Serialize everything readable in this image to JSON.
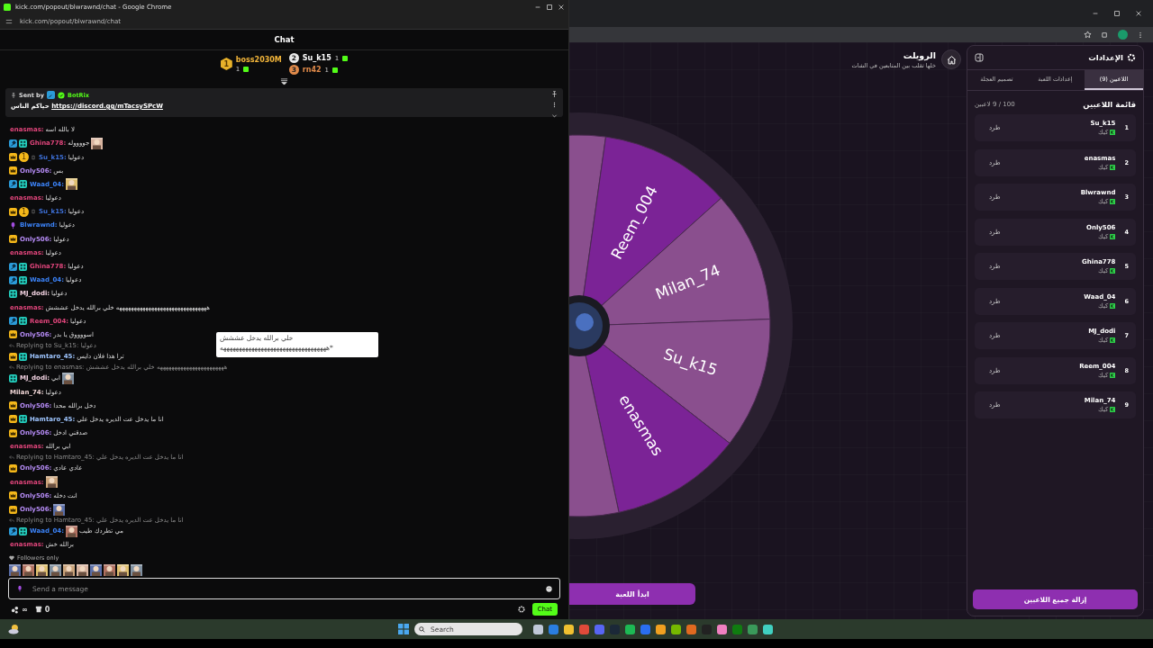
{
  "chat_window": {
    "title": "kick.com/popout/blwrawnd/chat - Google Chrome",
    "url": "kick.com/popout/blwrawnd/chat",
    "heading": "Chat",
    "top_gifter": {
      "rank": "1",
      "name": "boss2030M",
      "count": "1"
    },
    "runners_up": [
      {
        "rank": "2",
        "name": "Su_k15",
        "count": "1"
      },
      {
        "rank": "3",
        "name": "rn42",
        "count": "1"
      }
    ],
    "pinned": {
      "label": "Sent by",
      "sender": "BotRix",
      "text": "حياكم الناس",
      "link": "https://discord.gg/mTacsySPcW"
    },
    "messages": [
      {
        "user": "enasmas:",
        "color": "#e0457b",
        "text": "لا بالله اسه"
      },
      {
        "user": "Ghina778:",
        "color": "#e0457b",
        "badges": [
          {
            "kind": "hammer"
          },
          {
            "kind": "og"
          }
        ],
        "text": "جووووله",
        "emote_after": {
          "kind": "picture"
        }
      },
      {
        "user": "Su_k15:",
        "color": "#3d6fd6",
        "badges": [
          {
            "kind": "crown"
          },
          {
            "kind": "coin",
            "label": "1"
          },
          {
            "kind": "emblem"
          }
        ],
        "text": "دعوليا"
      },
      {
        "user": "Only506:",
        "color": "#b58bf5",
        "badges": [
          {
            "kind": "crown"
          }
        ],
        "text": "بس"
      },
      {
        "user": "Waad_04:",
        "color": "#3b82f6",
        "badges": [
          {
            "kind": "hammer"
          },
          {
            "kind": "og"
          }
        ],
        "emote_after": {
          "kind": "picture"
        }
      },
      {
        "user": "enasmas:",
        "color": "#e0457b",
        "text": "دعوليا"
      },
      {
        "user": "Su_k15:",
        "color": "#3d6fd6",
        "badges": [
          {
            "kind": "crown"
          },
          {
            "kind": "coin",
            "label": "1"
          },
          {
            "kind": "emblem"
          }
        ],
        "text": "دعوليا"
      },
      {
        "user": "Blwrawnd:",
        "color": "#3b82f6",
        "badges": [
          {
            "kind": "mic"
          }
        ],
        "text": "دعوليا"
      },
      {
        "user": "Only506:",
        "color": "#b58bf5",
        "badges": [
          {
            "kind": "crown"
          }
        ],
        "text": "دعوليا"
      },
      {
        "user": "enasmas:",
        "color": "#e0457b",
        "text": "دعوليا"
      },
      {
        "user": "Ghina778:",
        "color": "#e0457b",
        "badges": [
          {
            "kind": "hammer"
          },
          {
            "kind": "og"
          }
        ],
        "text": "دعوليا"
      },
      {
        "user": "Waad_04:",
        "color": "#3b82f6",
        "badges": [
          {
            "kind": "hammer"
          },
          {
            "kind": "og"
          }
        ],
        "text": "دعوليا"
      },
      {
        "user": "MJ_dodi:",
        "color": "#f3d3e2",
        "badges": [
          {
            "kind": "og"
          }
        ],
        "text": "دعوليا"
      },
      {
        "user": "enasmas:",
        "color": "#e0457b",
        "text": "هههههههههههههههههههههههههههههههه خلي برالله يدخل عششش"
      },
      {
        "user": "Reem_004:",
        "color": "#e0457b",
        "badges": [
          {
            "kind": "hammer"
          },
          {
            "kind": "og"
          }
        ],
        "text": "دعوليا"
      },
      {
        "user": "Only506:",
        "color": "#b58bf5",
        "badges": [
          {
            "kind": "crown"
          }
        ],
        "text": "اسووووق يا بدر"
      },
      {
        "reply": "Replying to Su_k15: دعوليا",
        "user": "Hamtaro_45:",
        "color": "#9ec5ff",
        "badges": [
          {
            "kind": "crown"
          },
          {
            "kind": "og"
          }
        ],
        "text": "ترا هذا فلان دايس"
      },
      {
        "reply": "Replying to enasmas: هههههههههههههههههههههههه خلي برالله يدخل عششش",
        "user": "MJ_dodi:",
        "color": "#f3d3e2",
        "badges": [
          {
            "kind": "og"
          }
        ],
        "text": "ابي",
        "emote_after": {
          "kind": "picture"
        }
      },
      {
        "user": "Milan_74:",
        "color": "#f0d6d6",
        "text": "دعوليا"
      },
      {
        "user": "Only506:",
        "color": "#b58bf5",
        "badges": [
          {
            "kind": "crown"
          }
        ],
        "text": "دخل برالله محدا"
      },
      {
        "user": "Hamtaro_45:",
        "color": "#9ec5ff",
        "badges": [
          {
            "kind": "crown"
          },
          {
            "kind": "og"
          }
        ],
        "text": "انا ما يدخل عت الديره يدخل علي"
      },
      {
        "user": "Only506:",
        "color": "#b58bf5",
        "badges": [
          {
            "kind": "crown"
          }
        ],
        "text": "صدقني ادخل"
      },
      {
        "user": "enasmas:",
        "color": "#e0457b",
        "text": "ابي برالله"
      },
      {
        "reply": "Replying to Hamtaro_45: انا ما يدخل عت الديره يدخل علي",
        "user": "Only506:",
        "color": "#b58bf5",
        "badges": [
          {
            "kind": "crown"
          }
        ],
        "text": "عادي عادي"
      },
      {
        "user": "enasmas:",
        "color": "#e0457b",
        "emote_after": {
          "kind": "picture"
        }
      },
      {
        "user": "Only506:",
        "color": "#b58bf5",
        "badges": [
          {
            "kind": "crown"
          }
        ],
        "text": "انت دخله"
      },
      {
        "user": "Only506:",
        "color": "#b58bf5",
        "badges": [
          {
            "kind": "crown"
          }
        ],
        "emote_after": {
          "kind": "picture"
        }
      },
      {
        "reply": "Replying to Hamtaro_45: انا ما يدخل عت الديره يدخل علي",
        "user": "Waad_04:",
        "color": "#3b82f6",
        "badges": [
          {
            "kind": "hammer"
          },
          {
            "kind": "og"
          }
        ],
        "text": "مي تطردك طيب",
        "emote_before": {
          "kind": "picture"
        }
      },
      {
        "user": "enasmas:",
        "color": "#e0457b",
        "text": "برالله خش"
      }
    ],
    "tooltip": {
      "lines": [
        "خلي برالله يدخل عششش",
        "ههههههههههههههههههههههههههههههههههه*"
      ]
    },
    "followers_only": "Followers only",
    "emotes": [
      {
        "kind": "picture"
      },
      {
        "kind": "picture"
      },
      {
        "kind": "picture"
      },
      {
        "kind": "picture"
      },
      {
        "kind": "picture"
      },
      {
        "kind": "picture"
      },
      {
        "kind": "picture"
      },
      {
        "kind": "picture"
      },
      {
        "kind": "picture"
      },
      {
        "kind": "picture"
      }
    ],
    "input": {
      "placeholder": "Send a message"
    },
    "footer": {
      "viewers": "∞",
      "points": "0",
      "send": "Chat"
    }
  },
  "roulette": {
    "title": "الرويلت",
    "subtitle": "خلها تقلب بين المتابعين في الشات",
    "segments": [
      {
        "color": "#8a4f8e"
      },
      {
        "label": "Reem_004",
        "color": "#7b2396"
      },
      {
        "label": "Milan_74",
        "color": "#8a4f8e"
      },
      {
        "label": "Su_k15",
        "color": "#8a4f8e"
      },
      {
        "label": "enasmas",
        "color": "#7b2396"
      },
      {
        "color": "#8a4f8e"
      }
    ],
    "start_button": "ابدأ اللعبة"
  },
  "settings": {
    "title": "الإعدادات",
    "tabs": [
      {
        "label": "اللاعبين (9)",
        "selected": true
      },
      {
        "label": "إعدادات اللعبة",
        "selected": false
      },
      {
        "label": "تصميم العجلة",
        "selected": false
      }
    ],
    "list_title": "قائمة اللاعبين",
    "count": "100 / 9 لاعبين",
    "players": [
      {
        "number": "1",
        "name": "Su_k15",
        "platform": "كيك",
        "action": "طرد"
      },
      {
        "number": "2",
        "name": "enasmas",
        "platform": "كيك",
        "action": "طرد"
      },
      {
        "number": "3",
        "name": "Blwrawnd",
        "platform": "كيك",
        "action": "طرد"
      },
      {
        "number": "4",
        "name": "Only506",
        "platform": "كيك",
        "action": "طرد"
      },
      {
        "number": "5",
        "name": "Ghina778",
        "platform": "كيك",
        "action": "طرد"
      },
      {
        "number": "6",
        "name": "Waad_04",
        "platform": "كيك",
        "action": "طرد"
      },
      {
        "number": "7",
        "name": "MJ_dodi",
        "platform": "كيك",
        "action": "طرد"
      },
      {
        "number": "8",
        "name": "Reem_004",
        "platform": "كيك",
        "action": "طرد"
      },
      {
        "number": "9",
        "name": "Milan_74",
        "platform": "كيك",
        "action": "طرد"
      }
    ],
    "remove_all": "إزالة جميع اللاعبين"
  },
  "taskbar": {
    "placeholder": "Search"
  }
}
